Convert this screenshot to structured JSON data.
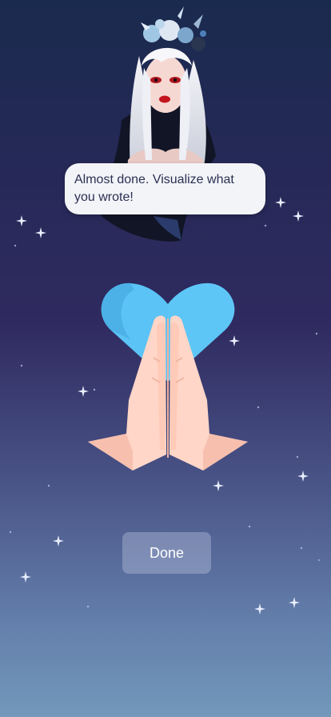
{
  "assistant": {
    "message": "Almost done. Visualize what you wrote!"
  },
  "hero": {
    "icons": [
      "heart-icon",
      "praying-hands-icon"
    ],
    "colors": {
      "heart": "#5bc3f5",
      "hands": "#ffd6c7"
    }
  },
  "actions": {
    "done_label": "Done"
  }
}
